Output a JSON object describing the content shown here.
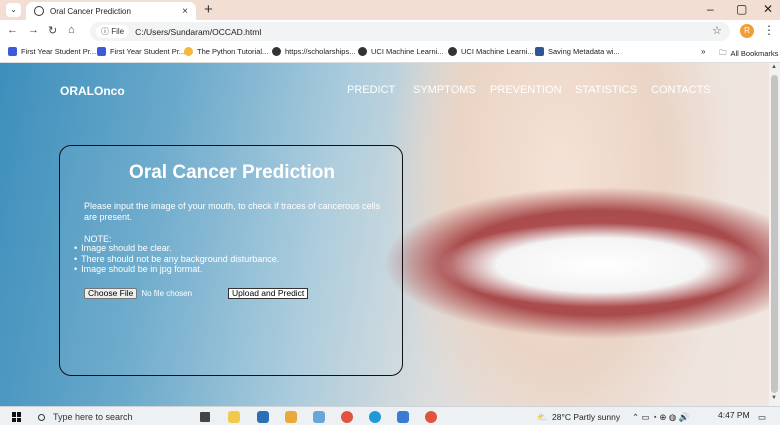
{
  "browser": {
    "tab_title": "Oral Cancer Prediction",
    "tab_close": "×",
    "new_tab": "+",
    "window_controls": [
      "–",
      "▢",
      "✕"
    ],
    "nav": {
      "back": "←",
      "forward": "→",
      "reload": "↻",
      "home": "⌂"
    },
    "site_info": "ⓘ File",
    "url": "C:/Users/Sundaram/OCCAD.html",
    "profile_initial": "R",
    "bookmarks": [
      {
        "label": "First Year Student Pr...",
        "color": "#3b5bdb"
      },
      {
        "label": "First Year Student Pr...",
        "color": "#3b5bdb"
      },
      {
        "label": "The Python Tutorial...",
        "color": "#f2b93b"
      },
      {
        "label": "https://scholarships...",
        "color": "#333333"
      },
      {
        "label": "UCI Machine Learni...",
        "color": "#333333"
      },
      {
        "label": "UCI Machine Learni...",
        "color": "#333333"
      },
      {
        "label": "Saving Metadata wi...",
        "color": "#2b5797"
      }
    ],
    "bookmarks_overflow": "»",
    "all_bookmarks": "All Bookmarks"
  },
  "site": {
    "logo": "ORALOnco",
    "nav": [
      "PREDICT",
      "SYMPTOMS",
      "PREVENTION",
      "STATISTICS",
      "CONTACTS"
    ]
  },
  "card": {
    "title": "Oral Cancer Prediction",
    "description": "Please input the image of your mouth, to check if traces of cancerous cells are present.",
    "note_label": "NOTE:",
    "notes": [
      "Image should be clear.",
      "There should not be any background disturbance.",
      "Image should be in jpg format."
    ],
    "choose_file": "Choose File",
    "no_file": "No file chosen",
    "upload_button": "Upload and Predict"
  },
  "taskbar": {
    "search_placeholder": "Type here to search",
    "weather": "28°C  Partly sunny",
    "time": "4:47 PM"
  },
  "colors": {
    "tab_strip": "#f3ded3",
    "page_blue": "#3d8fbc",
    "profile": "#f29d38"
  }
}
